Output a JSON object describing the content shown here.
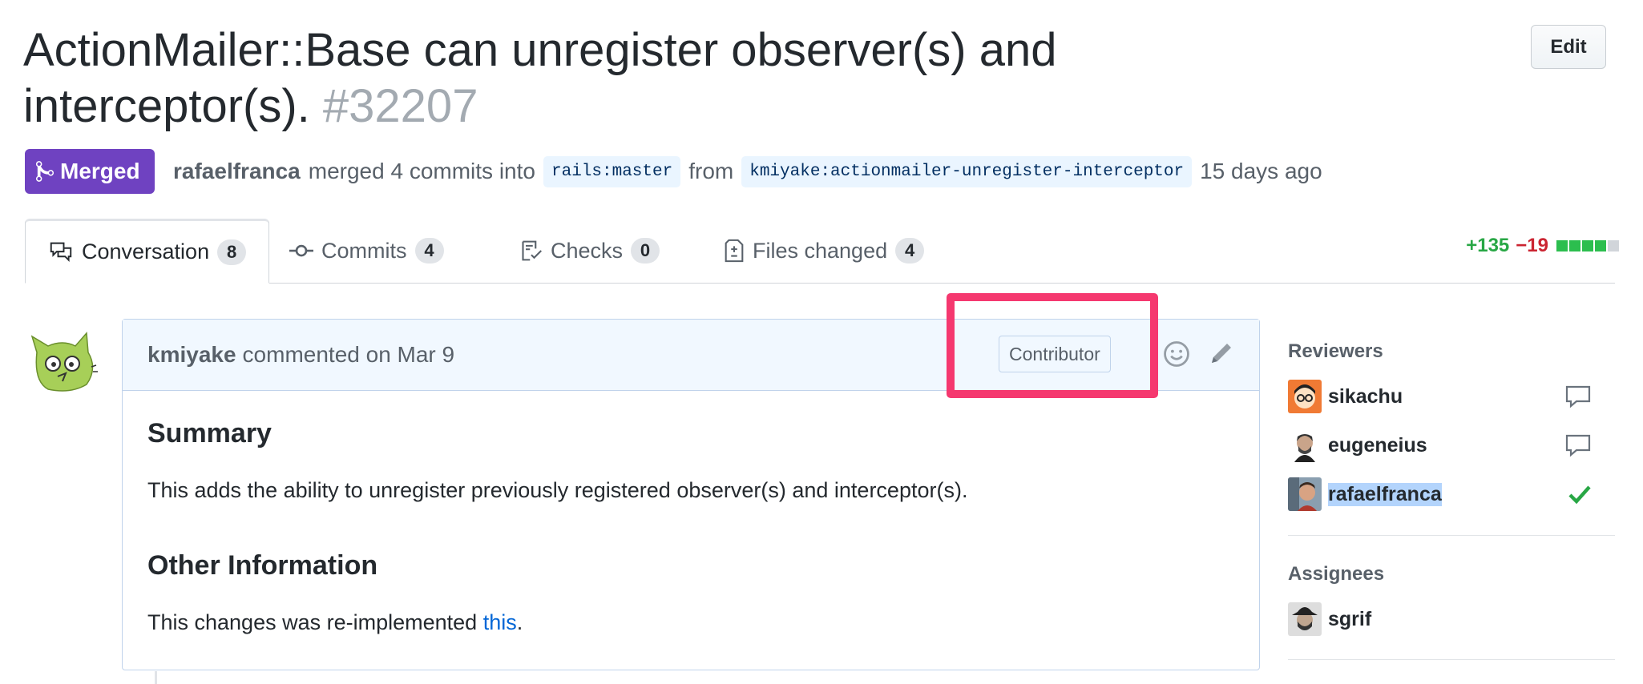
{
  "title": {
    "text": "ActionMailer::Base can unregister observer(s) and interceptor(s).",
    "number": "#32207"
  },
  "edit_button": "Edit",
  "state": {
    "label": "Merged",
    "color": "#6f42c1"
  },
  "meta": {
    "author": "rafaelfranca",
    "action": "merged 4 commits into",
    "base_branch": "rails:master",
    "from": "from",
    "head_branch": "kmiyake:actionmailer-unregister-interceptor",
    "time": "15 days ago"
  },
  "tabs": [
    {
      "label": "Conversation",
      "count": "8",
      "icon": "comment-discussion-icon"
    },
    {
      "label": "Commits",
      "count": "4",
      "icon": "git-commit-icon"
    },
    {
      "label": "Checks",
      "count": "0",
      "icon": "checklist-icon"
    },
    {
      "label": "Files changed",
      "count": "4",
      "icon": "diff-icon"
    }
  ],
  "diffstat": {
    "additions": "+135",
    "deletions": "−19",
    "blocks_green": 4,
    "blocks_total": 5
  },
  "comment": {
    "author": "kmiyake",
    "action": "commented on Mar 9",
    "badge": "Contributor",
    "heading1": "Summary",
    "para1": "This adds the ability to unregister previously registered observer(s) and interceptor(s).",
    "heading2": "Other Information",
    "para2_prefix": "This changes was re-implemented ",
    "para2_link": "this",
    "para2_suffix": "."
  },
  "sidebar": {
    "reviewers_heading": "Reviewers",
    "reviewers": [
      {
        "name": "sikachu",
        "status": "commented"
      },
      {
        "name": "eugeneius",
        "status": "commented"
      },
      {
        "name": "rafaelfranca",
        "status": "approved"
      }
    ],
    "assignees_heading": "Assignees",
    "assignees": [
      {
        "name": "sgrif"
      }
    ]
  },
  "colors": {
    "accent_link": "#0366d6",
    "highlight": "#f5386f",
    "add": "#28a745",
    "del": "#cb2431"
  }
}
